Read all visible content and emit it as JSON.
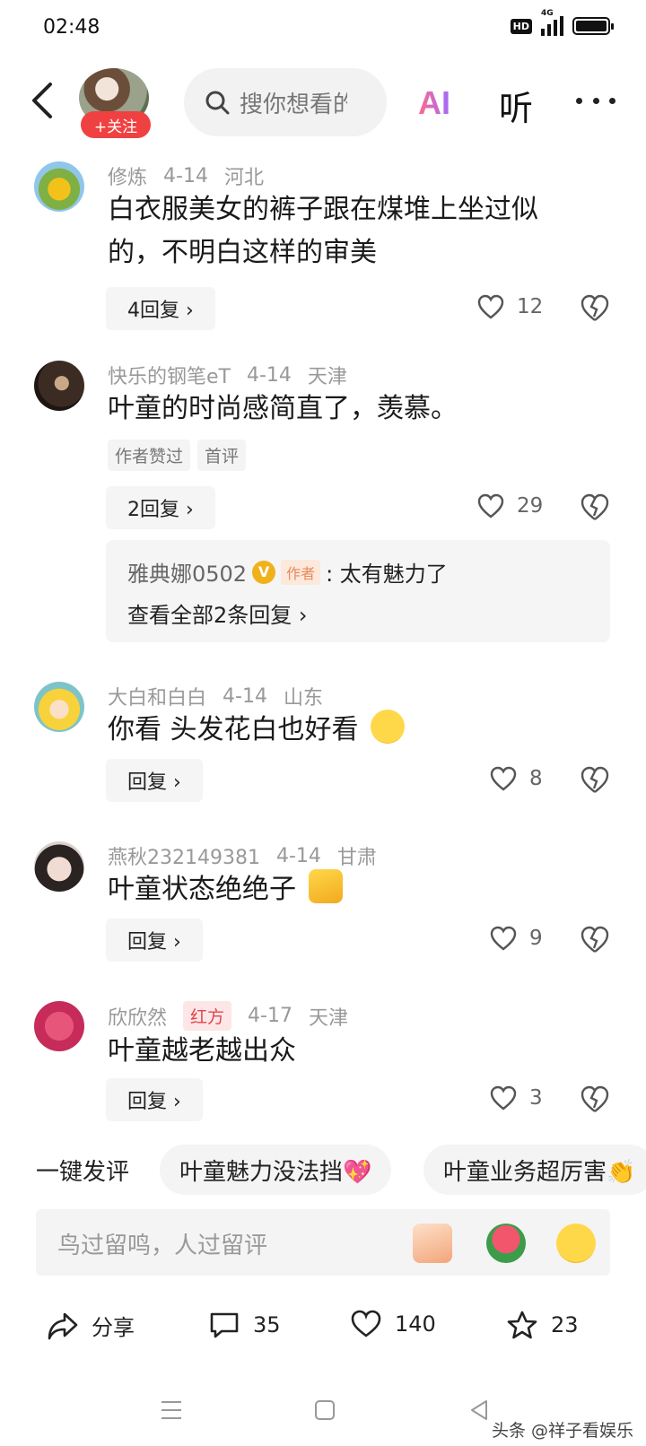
{
  "status_bar": {
    "time": "02:48",
    "hd": "HD",
    "network": "4G"
  },
  "header": {
    "follow_label": "+关注",
    "search_placeholder": "搜你想看的",
    "ai_label": "AI",
    "listen_label": "听"
  },
  "comments": [
    {
      "user": "修炼",
      "date": "4-14",
      "location": "河北",
      "text": "白衣服美女的裤子跟在煤堆上坐过似的，不明白这样的审美",
      "reply_label": "4回复 ›",
      "likes": "12"
    },
    {
      "user": "快乐的钢笔eT",
      "date": "4-14",
      "location": "天津",
      "text": "叶童的时尚感简直了，羡慕。",
      "tags": [
        "作者赞过",
        "首评"
      ],
      "reply_label": "2回复 ›",
      "likes": "29",
      "author_reply": {
        "name": "雅典娜0502",
        "author_tag": "作者",
        "text": ": 太有魅力了",
        "view_all": "查看全部2条回复 ›"
      }
    },
    {
      "user": "大白和白白",
      "date": "4-14",
      "location": "山东",
      "text": "你看 头发花白也好看",
      "reply_label": "回复 ›",
      "likes": "8"
    },
    {
      "user": "燕秋232149381",
      "date": "4-14",
      "location": "甘肃",
      "text": "叶童状态绝绝子",
      "reply_label": "回复 ›",
      "likes": "9"
    },
    {
      "user": "欣欣然",
      "badge": "红方",
      "date": "4-17",
      "location": "天津",
      "text": "叶童越老越出众",
      "reply_label": "回复 ›",
      "likes": "3"
    }
  ],
  "quick_comments": {
    "label": "一键发评",
    "chips": [
      "叶童魅力没法挡💖",
      "叶童业务超厉害👏"
    ]
  },
  "input": {
    "placeholder": "鸟过留鸣，人过留评"
  },
  "actions": {
    "share": "分享",
    "comments": "35",
    "likes": "140",
    "favorites": "23"
  },
  "watermark": "头条 @祥子看娱乐",
  "colors": {
    "accent_red": "#f04142",
    "verified_gold": "#f0b21b"
  }
}
